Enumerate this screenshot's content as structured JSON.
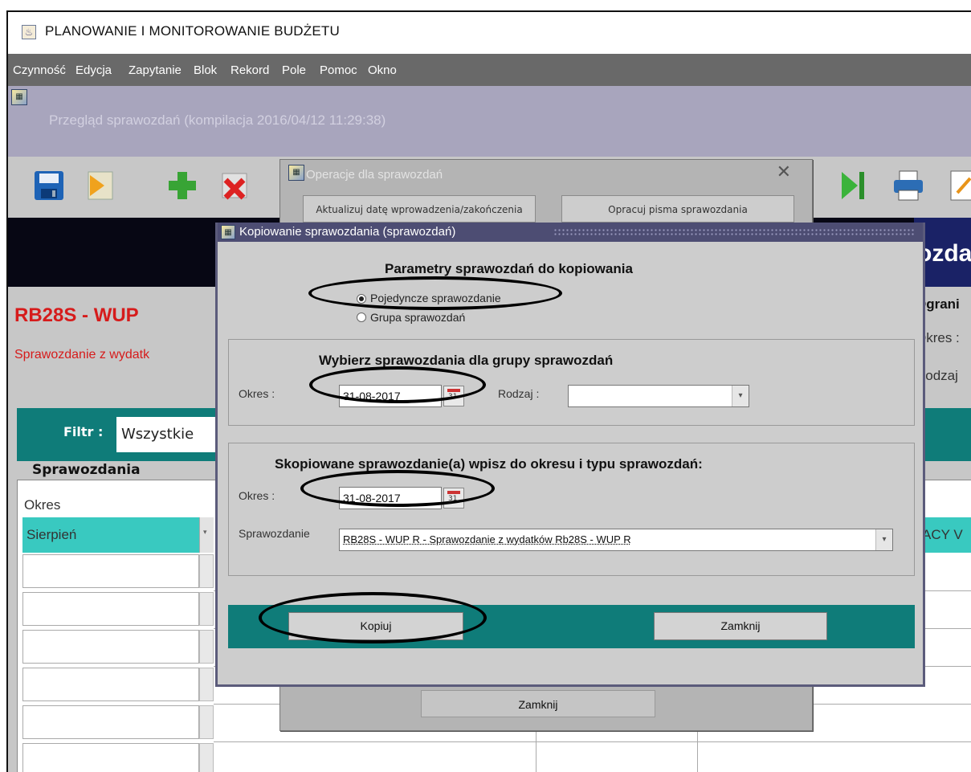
{
  "window": {
    "title": "PLANOWANIE I MONITOROWANIE BUDŻETU"
  },
  "menu": [
    {
      "label": "Czynność"
    },
    {
      "label": "Edycja"
    },
    {
      "label": "Zapytanie"
    },
    {
      "label": "Blok"
    },
    {
      "label": "Rekord"
    },
    {
      "label": "Pole"
    },
    {
      "label": "Pomoc"
    },
    {
      "label": "Okno"
    }
  ],
  "form": {
    "title": "Przegląd sprawozdań (kompilacja 2016/04/12 11:29:38)",
    "report_code": "RB28S - WUP",
    "report_desc": "Sprawozdanie z wydatk",
    "header_right": "ozda",
    "right_labels": [
      "Ograni",
      "Okres :",
      "Rodzaj"
    ],
    "filter_label": "Filtr :",
    "filter_value": "Wszystkie",
    "group_label": "Sprawozdania",
    "column_okres": "Okres",
    "okres_value": "Sierpień",
    "right_cell": "ACY V"
  },
  "ops_dialog": {
    "title": "Operacje dla sprawozdań",
    "btn1": "Aktualizuj datę wprowadzenia/zakończenia",
    "btn2": "Opracuj pisma sprawozdania",
    "close": "Zamknij"
  },
  "copy_dialog": {
    "title": "Kopiowanie sprawozdania (sprawozdań)",
    "heading": "Parametry sprawozdań do kopiowania",
    "radio_single": "Pojedyncze sprawozdanie",
    "radio_group": "Grupa sprawozdań",
    "radio_selected": "single",
    "section1_heading": "Wybierz sprawozdania dla grupy sprawozdań",
    "okres_label": "Okres :",
    "okres_value1": "31-08-2017",
    "calendar_day": "31",
    "rodzaj_label": "Rodzaj :",
    "rodzaj_value": "",
    "section2_heading": "Skopiowane sprawozdanie(a) wpisz do okresu i typu sprawozdań:",
    "okres_value2": "31-08-2017",
    "sprawozdanie_label": "Sprawozdanie",
    "sprawozdanie_value": "RB28S - WUP R - Sprawozdanie z wydatków Rb28S - WUP R",
    "btn_copy": "Kopiuj",
    "btn_close": "Zamknij"
  }
}
